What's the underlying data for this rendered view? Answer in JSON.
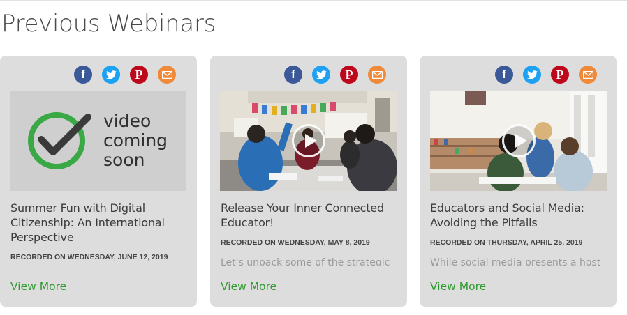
{
  "page": {
    "title": "Previous Webinars"
  },
  "share_icons": {
    "facebook": "facebook-icon",
    "twitter": "twitter-icon",
    "pinterest": "pinterest-icon",
    "email": "email-icon",
    "colors": {
      "facebook": "#3b5998",
      "twitter": "#1da1f2",
      "pinterest": "#bd081c",
      "email": "#ef8a3a"
    }
  },
  "accent_color": "#2e9a2e",
  "webinars": [
    {
      "title": "Summer Fun with Digital Citizenship: An International Perspective",
      "date": "RECORDED ON WEDNESDAY, JUNE 12, 2019",
      "excerpt": "",
      "view_more": "View More",
      "thumbnail_lines": [
        "video",
        "coming",
        "soon"
      ]
    },
    {
      "title": "Release Your Inner Connected Educator!",
      "date": "RECORDED ON WEDNESDAY, MAY 8, 2019",
      "excerpt": "Let's unpack some of the strategic",
      "view_more": "View More"
    },
    {
      "title": "Educators and Social Media: Avoiding the Pitfalls",
      "date": "RECORDED ON THURSDAY, APRIL 25, 2019",
      "excerpt": "While social media presents a host",
      "view_more": "View More"
    }
  ]
}
